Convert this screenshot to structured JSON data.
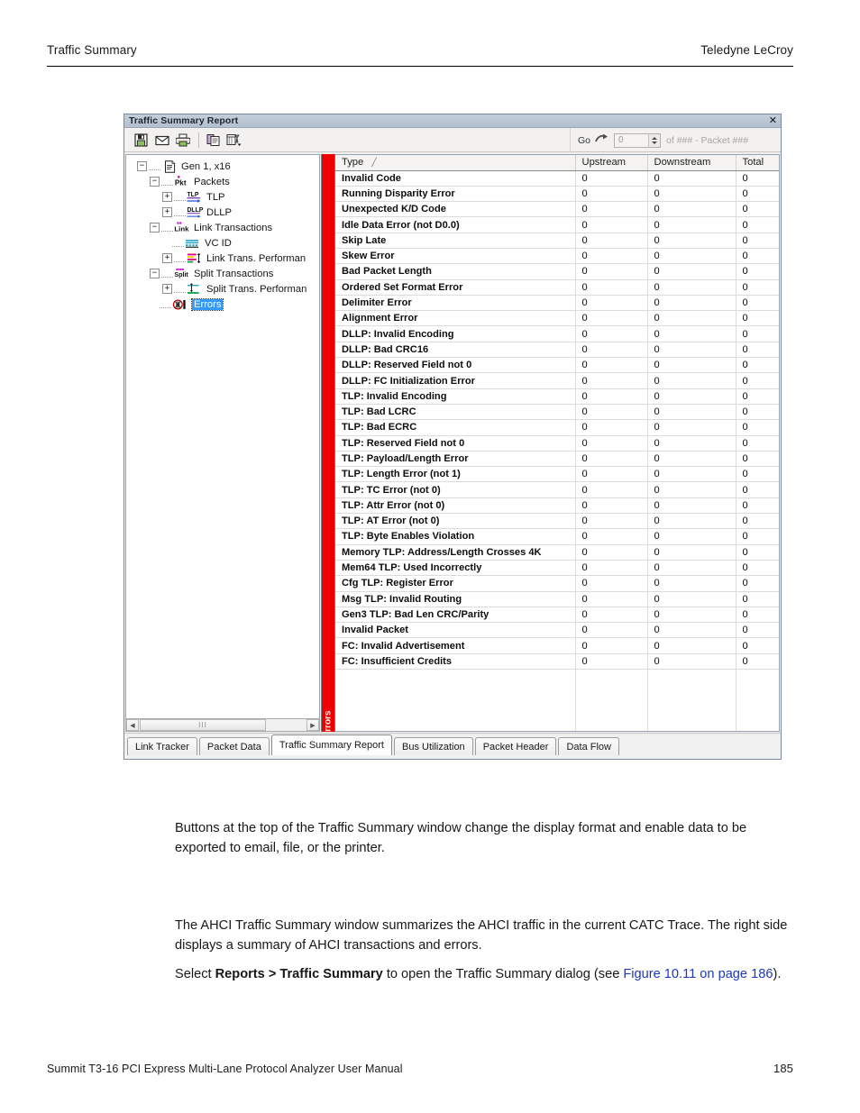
{
  "page": {
    "header_left": "Traffic Summary",
    "header_right": "Teledyne LeCroy",
    "footer_left": "Summit T3-16 PCI Express Multi-Lane Protocol Analyzer User Manual",
    "footer_page": "185"
  },
  "paragraphs": {
    "p1": "Buttons at the top of the Traffic Summary window change the display format and enable data to be exported to email, file, or the printer.",
    "p2": "The AHCI Traffic Summary window summarizes the AHCI traffic in the current CATC Trace. The right side displays a summary of AHCI transactions and errors.",
    "p3_a": "Select ",
    "p3_b": "Reports > Traffic Summary",
    "p3_c": " to open the Traffic Summary dialog (see ",
    "p3_link": "Figure 10.11 on page 186",
    "p3_d": ")."
  },
  "window": {
    "title": "Traffic Summary Report",
    "close_label": "✕",
    "toolbar": {
      "save_tip": "Save",
      "email_tip": "Email",
      "print_tip": "Print",
      "copy_tip": "Copy",
      "view_tip": "View Options"
    },
    "go": {
      "label": "Go",
      "value": "0",
      "placeholder": "0",
      "suffix": "of ### - Packet ###"
    }
  },
  "tree": {
    "nodes": [
      {
        "label": "Gen 1, x16",
        "depth": 0,
        "expander": "−",
        "icon": "report-icon",
        "selected": false
      },
      {
        "label": "Packets",
        "depth": 1,
        "expander": "−",
        "icon": "pkt-icon",
        "selected": false
      },
      {
        "label": "TLP",
        "depth": 2,
        "expander": "+",
        "icon": "tlp-icon",
        "selected": false
      },
      {
        "label": "DLLP",
        "depth": 2,
        "expander": "+",
        "icon": "dllp-icon",
        "selected": false
      },
      {
        "label": "Link Transactions",
        "depth": 1,
        "expander": "−",
        "icon": "link-icon",
        "selected": false
      },
      {
        "label": "VC ID",
        "depth": 2,
        "expander": "",
        "icon": "vcid-icon",
        "selected": false
      },
      {
        "label": "Link Trans. Performan",
        "depth": 2,
        "expander": "+",
        "icon": "link-perf-icon",
        "selected": false
      },
      {
        "label": "Split Transactions",
        "depth": 1,
        "expander": "−",
        "icon": "split-icon",
        "selected": false
      },
      {
        "label": "Split Trans. Performan",
        "depth": 2,
        "expander": "+",
        "icon": "split-perf-icon",
        "selected": false
      },
      {
        "label": "Errors",
        "depth": 1,
        "expander": "",
        "icon": "errors-icon",
        "selected": true
      }
    ],
    "side_strip_label": "Errors",
    "scrollbar": {
      "left_arrow": "◀",
      "right_arrow": "▶",
      "grip": "III"
    }
  },
  "grid": {
    "columns": [
      "Type",
      "Upstream",
      "Downstream",
      "Total"
    ],
    "sort_indicator": "╱",
    "rows": [
      {
        "type": "Invalid Code",
        "upstream": "0",
        "downstream": "0",
        "total": "0"
      },
      {
        "type": "Running Disparity Error",
        "upstream": "0",
        "downstream": "0",
        "total": "0"
      },
      {
        "type": "Unexpected K/D Code",
        "upstream": "0",
        "downstream": "0",
        "total": "0"
      },
      {
        "type": "Idle Data Error (not D0.0)",
        "upstream": "0",
        "downstream": "0",
        "total": "0"
      },
      {
        "type": "Skip Late",
        "upstream": "0",
        "downstream": "0",
        "total": "0"
      },
      {
        "type": "Skew Error",
        "upstream": "0",
        "downstream": "0",
        "total": "0"
      },
      {
        "type": "Bad Packet Length",
        "upstream": "0",
        "downstream": "0",
        "total": "0"
      },
      {
        "type": "Ordered Set Format Error",
        "upstream": "0",
        "downstream": "0",
        "total": "0"
      },
      {
        "type": "Delimiter Error",
        "upstream": "0",
        "downstream": "0",
        "total": "0"
      },
      {
        "type": "Alignment Error",
        "upstream": "0",
        "downstream": "0",
        "total": "0"
      },
      {
        "type": "DLLP: Invalid Encoding",
        "upstream": "0",
        "downstream": "0",
        "total": "0"
      },
      {
        "type": "DLLP: Bad CRC16",
        "upstream": "0",
        "downstream": "0",
        "total": "0"
      },
      {
        "type": "DLLP: Reserved Field not 0",
        "upstream": "0",
        "downstream": "0",
        "total": "0"
      },
      {
        "type": "DLLP: FC Initialization Error",
        "upstream": "0",
        "downstream": "0",
        "total": "0"
      },
      {
        "type": "TLP: Invalid Encoding",
        "upstream": "0",
        "downstream": "0",
        "total": "0"
      },
      {
        "type": "TLP: Bad LCRC",
        "upstream": "0",
        "downstream": "0",
        "total": "0"
      },
      {
        "type": "TLP: Bad ECRC",
        "upstream": "0",
        "downstream": "0",
        "total": "0"
      },
      {
        "type": "TLP: Reserved Field not 0",
        "upstream": "0",
        "downstream": "0",
        "total": "0"
      },
      {
        "type": "TLP: Payload/Length Error",
        "upstream": "0",
        "downstream": "0",
        "total": "0"
      },
      {
        "type": "TLP: Length Error (not 1)",
        "upstream": "0",
        "downstream": "0",
        "total": "0"
      },
      {
        "type": "TLP: TC Error (not 0)",
        "upstream": "0",
        "downstream": "0",
        "total": "0"
      },
      {
        "type": "TLP: Attr Error (not 0)",
        "upstream": "0",
        "downstream": "0",
        "total": "0"
      },
      {
        "type": "TLP: AT Error (not 0)",
        "upstream": "0",
        "downstream": "0",
        "total": "0"
      },
      {
        "type": "TLP: Byte Enables Violation",
        "upstream": "0",
        "downstream": "0",
        "total": "0"
      },
      {
        "type": "Memory TLP: Address/Length Crosses 4K",
        "upstream": "0",
        "downstream": "0",
        "total": "0"
      },
      {
        "type": "Mem64 TLP: Used Incorrectly",
        "upstream": "0",
        "downstream": "0",
        "total": "0"
      },
      {
        "type": "Cfg TLP: Register Error",
        "upstream": "0",
        "downstream": "0",
        "total": "0"
      },
      {
        "type": "Msg TLP: Invalid Routing",
        "upstream": "0",
        "downstream": "0",
        "total": "0"
      },
      {
        "type": "Gen3 TLP: Bad Len CRC/Parity",
        "upstream": "0",
        "downstream": "0",
        "total": "0"
      },
      {
        "type": "Invalid Packet",
        "upstream": "0",
        "downstream": "0",
        "total": "0"
      },
      {
        "type": "FC: Invalid Advertisement",
        "upstream": "0",
        "downstream": "0",
        "total": "0"
      },
      {
        "type": "FC: Insufficient Credits",
        "upstream": "0",
        "downstream": "0",
        "total": "0"
      }
    ]
  },
  "tabs": [
    {
      "label": "Link Tracker",
      "active": false
    },
    {
      "label": "Packet Data",
      "active": false
    },
    {
      "label": "Traffic Summary Report",
      "active": true
    },
    {
      "label": "Bus Utilization",
      "active": false
    },
    {
      "label": "Packet Header",
      "active": false
    },
    {
      "label": "Data Flow",
      "active": false
    }
  ],
  "colors": {
    "error_strip": "#ee0000",
    "titlebar": "#b8c4d4",
    "selection": "#3399ff",
    "link": "#1c39bb"
  }
}
